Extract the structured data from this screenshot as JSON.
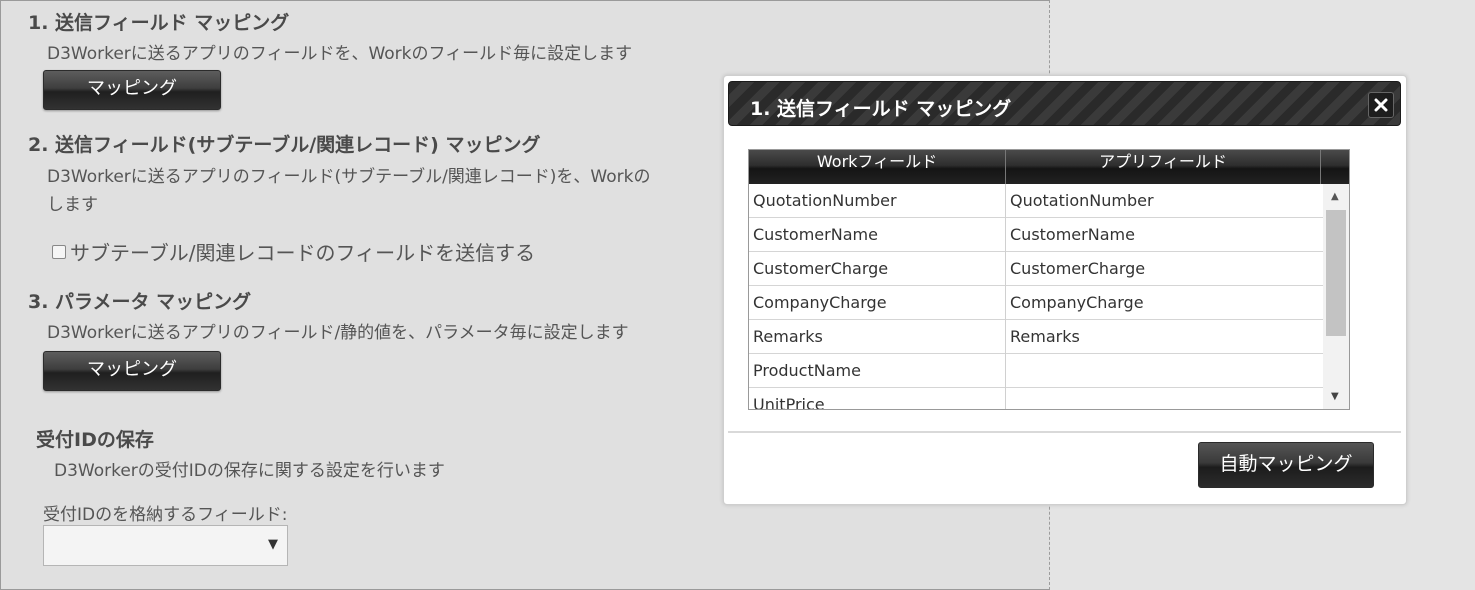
{
  "section1": {
    "title": "1. 送信フィールド マッピング",
    "desc": "D3Workerに送るアプリのフィールドを、Workのフィールド毎に設定します",
    "button": "マッピング"
  },
  "section2": {
    "title": "2. 送信フィールド(サブテーブル/関連レコード) マッピング",
    "desc_line1": "D3Workerに送るアプリのフィールド(サブテーブル/関連レコード)を、Workの",
    "desc_line2": "します",
    "checkbox_label": "サブテーブル/関連レコードのフィールドを送信する",
    "checkbox_checked": false
  },
  "section3": {
    "title": "3. パラメータ マッピング",
    "desc": "D3Workerに送るアプリのフィールド/静的値を、パラメータ毎に設定します",
    "button": "マッピング"
  },
  "receipt": {
    "title": "受付IDの保存",
    "desc": "D3Workerの受付IDの保存に関する設定を行います",
    "field_label": "受付IDのを格納するフィールド:",
    "select_value": ""
  },
  "modal": {
    "title": "1. 送信フィールド マッピング",
    "columns": [
      "Workフィールド",
      "アプリフィールド"
    ],
    "rows": [
      {
        "work": "QuotationNumber",
        "app": "QuotationNumber"
      },
      {
        "work": "CustomerName",
        "app": "CustomerName"
      },
      {
        "work": "CustomerCharge",
        "app": "CustomerCharge"
      },
      {
        "work": "CompanyCharge",
        "app": "CompanyCharge"
      },
      {
        "work": "Remarks",
        "app": "Remarks"
      },
      {
        "work": "ProductName",
        "app": ""
      },
      {
        "work": "UnitPrice",
        "app": ""
      }
    ],
    "auto_button": "自動マッピング"
  },
  "icons": {
    "close": "close-icon",
    "dropdown": "chevron-down-icon",
    "scroll_up": "scroll-up-arrow-icon",
    "scroll_down": "scroll-down-arrow-icon"
  }
}
